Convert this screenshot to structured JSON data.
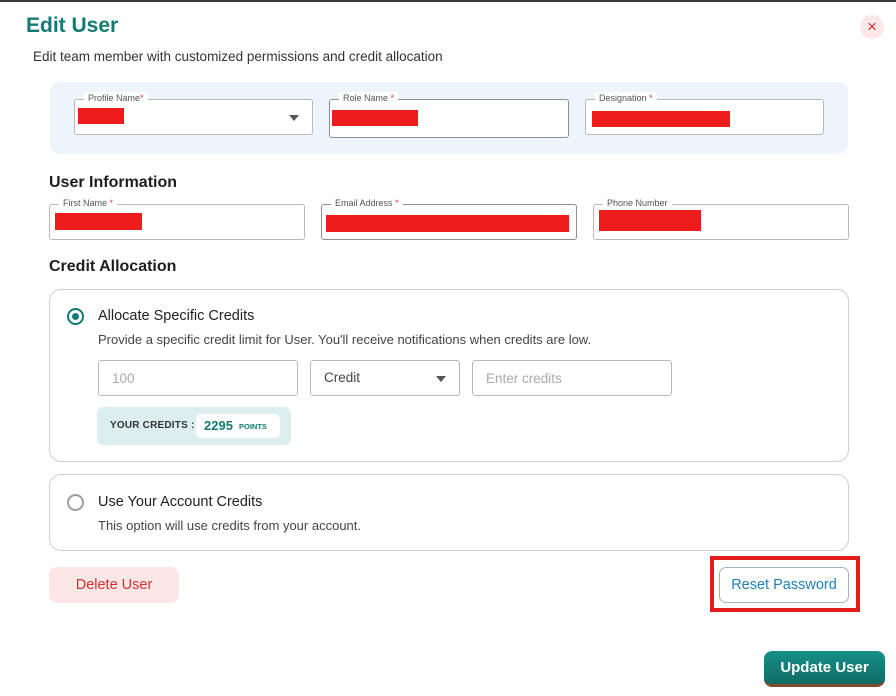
{
  "modal": {
    "title": "Edit User",
    "subtitle": "Edit team member with customized permissions and credit allocation",
    "close_glyph": "×"
  },
  "profile": {
    "profile_name_label": "Profile Name",
    "role_name_label": "Role Name",
    "designation_label": "Designation",
    "required_mark": "*"
  },
  "user_info": {
    "heading": "User Information",
    "first_name_label": "First Name",
    "email_label": "Email Address",
    "phone_label": "Phone Number",
    "required_mark": "*"
  },
  "credit": {
    "heading": "Credit Allocation",
    "specific": {
      "title": "Allocate Specific Credits",
      "description": "Provide a specific credit limit for User. You'll receive notifications when credits are low.",
      "amount_placeholder": "100",
      "type_value": "Credit",
      "enter_placeholder": "Enter credits",
      "your_credits_label": "YOUR CREDITS :",
      "your_credits_value": "2295",
      "your_credits_unit": "POINTS",
      "selected": true
    },
    "account": {
      "title": "Use Your Account Credits",
      "description": "This option will use credits from your account.",
      "selected": false
    }
  },
  "actions": {
    "delete": "Delete User",
    "reset": "Reset Password",
    "update": "Update User"
  },
  "colors": {
    "accent": "#147a73",
    "danger": "#d32f2f",
    "link": "#1f7fb6",
    "redaction": "#ee1c1c"
  }
}
